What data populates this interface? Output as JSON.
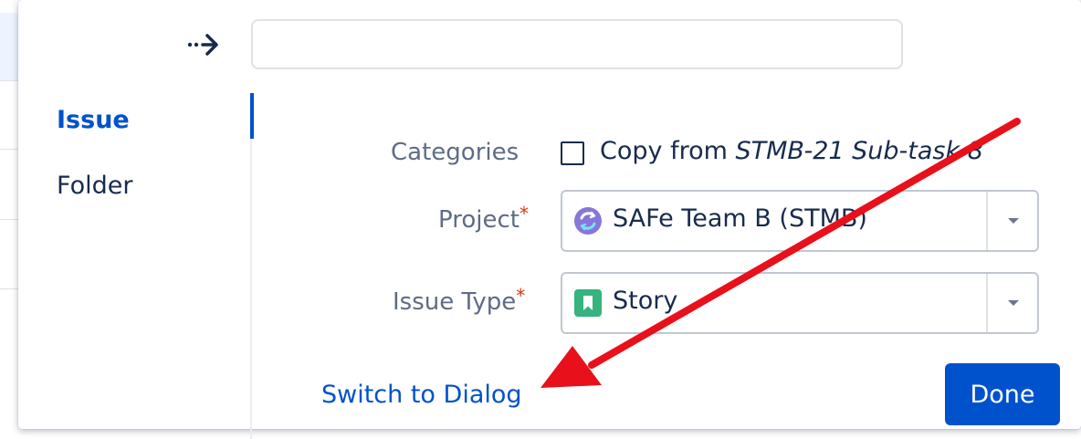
{
  "search": {
    "value": "",
    "placeholder": ""
  },
  "sidebar": {
    "items": [
      {
        "label": "Issue",
        "active": true
      },
      {
        "label": "Folder",
        "active": false
      }
    ]
  },
  "form": {
    "categories_label": "Categories",
    "copy_from_prefix": "Copy from ",
    "copy_from_issue": "STMB-21 Sub-task 8",
    "copy_checked": false,
    "project_label": "Project",
    "project_value": "SAFe Team B (STMB)",
    "issue_type_label": "Issue Type",
    "issue_type_value": "Story",
    "required_mark": "*"
  },
  "footer": {
    "switch_label": "Switch to Dialog",
    "done_label": "Done"
  },
  "icons": {
    "expand": "arrow-right-dotted-icon",
    "project": "project-avatar-icon",
    "issue_type": "story-icon",
    "dropdown": "chevron-down-icon"
  },
  "colors": {
    "accent": "#0052cc",
    "required": "#de350b",
    "story": "#36b37e",
    "annotation": "#e8101a",
    "project_avatar": "#8777d9"
  }
}
